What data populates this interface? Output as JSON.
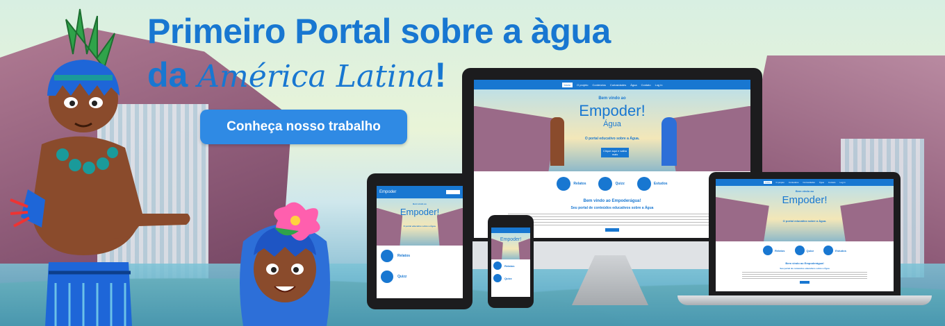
{
  "headline": {
    "line1": "Primeiro Portal sobre a àgua",
    "line2_prefix": "da",
    "line2_script": "América Latina",
    "line2_suffix": "!"
  },
  "cta_label": "Conheça nosso trabalho",
  "site": {
    "nav": [
      "Início",
      "O projeto",
      "Conteúdos",
      "Curiosidades",
      "Água",
      "Contato",
      "Log in"
    ],
    "logo_top": "Empoder",
    "logo_mark": "!",
    "logo_bottom": "Água",
    "tagline": "O portal educativo sobre a Água.",
    "hero_button": "Clique aqui e saiba mais",
    "greeting": "Bem vindo ao",
    "features": [
      {
        "label": "Relatos",
        "icon": "graduation-cap-icon"
      },
      {
        "label": "Quizz",
        "icon": "mask-icon"
      },
      {
        "label": "Estudos",
        "icon": "book-icon"
      }
    ],
    "welcome": "Bem vindo ao Empoderágua!",
    "subtitle": "Seu portal de conteúdos educativos sobre a Água"
  },
  "colors": {
    "brand": "#1877d1",
    "cta": "#2f8ae4"
  }
}
